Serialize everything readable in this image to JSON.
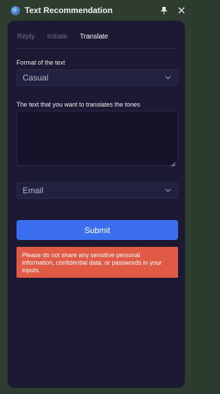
{
  "window": {
    "title": "Text Recommendation",
    "icons": {
      "app": "app-logo-icon",
      "pin": "pin-icon",
      "close": "close-icon"
    }
  },
  "tabs": [
    {
      "label": "Reply",
      "active": false
    },
    {
      "label": "Initiate",
      "active": false
    },
    {
      "label": "Translate",
      "active": true
    }
  ],
  "format": {
    "label": "Format of the text",
    "selected": "Casual"
  },
  "text_input": {
    "label": "The text that you want to translates the tones",
    "value": "",
    "placeholder": ""
  },
  "channel": {
    "selected": "Email"
  },
  "submit_label": "Submit",
  "warning": "Please do not share any sensitive personal information, confidential data, or passwords in your inputs.",
  "colors": {
    "panel": "#1c1a33",
    "accent": "#3b6ff0",
    "warning": "#e05a45"
  }
}
